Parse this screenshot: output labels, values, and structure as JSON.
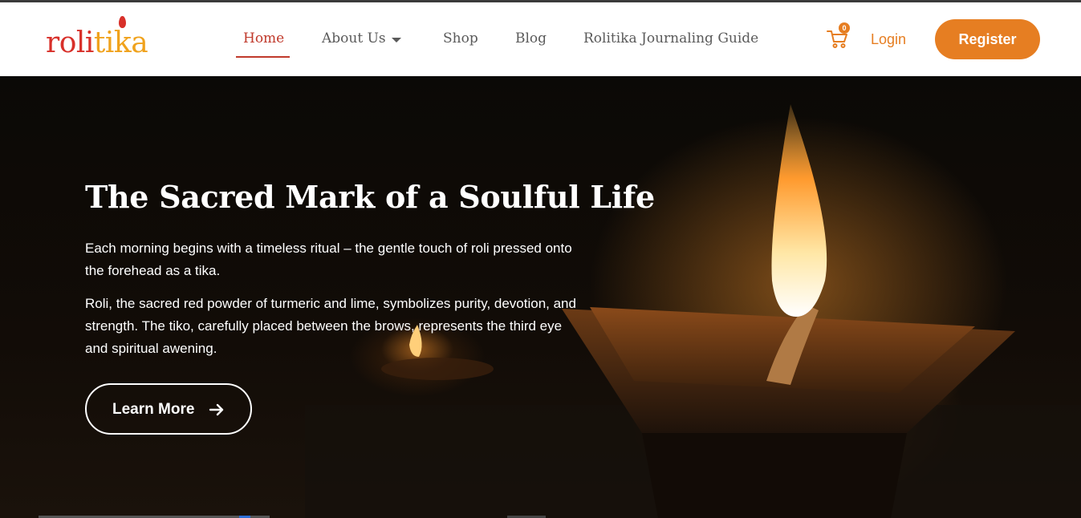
{
  "brand": {
    "logo_part1": "roli",
    "logo_part2": "tika"
  },
  "nav": {
    "items": [
      {
        "label": "Home",
        "active": true
      },
      {
        "label": "About Us",
        "active": false
      },
      {
        "label": "Shop",
        "active": false
      },
      {
        "label": "Blog",
        "active": false
      },
      {
        "label": "Rolitika Journaling Guide",
        "active": false
      }
    ]
  },
  "header_actions": {
    "cart_count": "0",
    "login_label": "Login",
    "register_label": "Register"
  },
  "hero": {
    "title": "The Sacred Mark of a Soulful Life",
    "paragraph1": "Each morning begins with a timeless ritual – the gentle touch of roli pressed onto the forehead as a tika.",
    "paragraph2": "Roli, the sacred red powder of turmeric and lime, symbolizes purity, devotion, and strength. The tiko, carefully placed between the brows, represents the third eye and spiritual awening.",
    "cta_label": "Learn More"
  },
  "colors": {
    "accent": "#e67e22",
    "nav_active": "#c0392b",
    "logo_red": "#d8302a",
    "logo_gold": "#f0a21c"
  },
  "icons": {
    "cart": "shopping-cart-icon",
    "caret": "chevron-down-icon",
    "arrow": "arrow-right-icon"
  }
}
